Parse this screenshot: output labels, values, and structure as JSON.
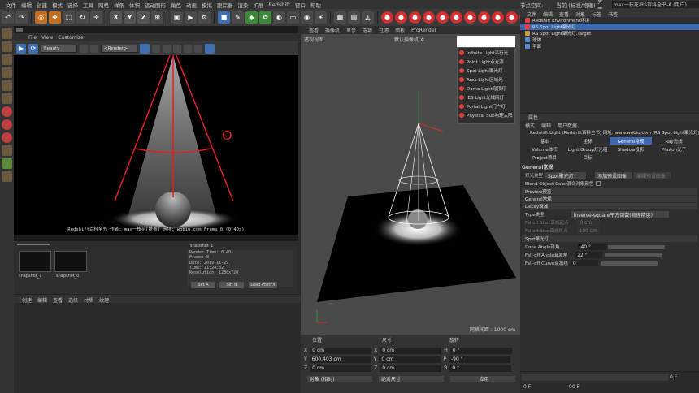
{
  "menubar": {
    "items": [
      "文件",
      "编辑",
      "创建",
      "模式",
      "选择",
      "工具",
      "网格",
      "样条",
      "体积",
      "运动图形",
      "角色",
      "动画",
      "模拟",
      "跟踪器",
      "渲染",
      "扩展",
      "Redshift",
      "窗口",
      "帮助"
    ],
    "node_space_label": "节点空间:",
    "node_space_value": "当前 (标准/物理)",
    "interface_label": "界面:",
    "interface_value": "max一枝花-RS百科全书-A (用户)"
  },
  "toolbar": {
    "axis_letters": [
      "X",
      "Y",
      "Z"
    ]
  },
  "viewport1": {
    "menu": [
      "File",
      "View",
      "Customize"
    ],
    "dropdown1": "Beauty",
    "dropdown2": "<Render>",
    "stamp": "Redshift百科全书  作者: max一枝花[扶善]  网址: wobiu.com  Frame 0  (0.40s)",
    "annotation": "O"
  },
  "snapshots": {
    "title": "snapshot_1",
    "items": [
      "snapshot_1",
      "snapshot_0"
    ],
    "info_lines": [
      "Render Time: 0.40s",
      "Frame: 0",
      "Date: 2019-11-29",
      "Time: 11:24:32",
      "Resolution: 1280x720"
    ],
    "buttons": [
      "Set A",
      "Set B",
      "Load PostFX"
    ]
  },
  "material_manager": {
    "menu": [
      "创建",
      "编辑",
      "查看",
      "选择",
      "材质",
      "纹理"
    ]
  },
  "viewport2": {
    "menu": [
      "查看",
      "摄像机",
      "显示",
      "选项",
      "过滤",
      "面板",
      "ProRender"
    ],
    "label": "透视视图",
    "camera": "默认摄像机 ✲",
    "grid_info": "网格间距 : 1000 cm"
  },
  "light_menu": {
    "items": [
      "Infinite Light平行光",
      "Point Light点光源",
      "Spot Light聚光灯",
      "Area Light区域光",
      "Dome Light穹顶灯",
      "IES Light光域网灯",
      "Portal Light门户灯",
      "Physical Sun物理太阳"
    ]
  },
  "coordinates": {
    "headers": [
      "位置",
      "尺寸",
      "旋转"
    ],
    "rows": [
      {
        "axis": "X",
        "pos": "0 cm",
        "size_axis": "X",
        "size": "0 cm",
        "rot_axis": "H",
        "rot": "0 °"
      },
      {
        "axis": "Y",
        "pos": "600.403 cm",
        "size_axis": "Y",
        "size": "0 cm",
        "rot_axis": "P",
        "rot": "-90 °"
      },
      {
        "axis": "Z",
        "pos": "0 cm",
        "size_axis": "Z",
        "size": "0 cm",
        "rot_axis": "B",
        "rot": "0 °"
      }
    ],
    "mode1": "对象 (相对)",
    "mode2": "绝对尺寸",
    "apply": "应用"
  },
  "object_manager": {
    "menu": [
      "文件",
      "编辑",
      "查看",
      "对象",
      "标签",
      "书签"
    ],
    "objects": [
      "Redshift Environment环境",
      "RS Spot Light聚光灯",
      "RS Spot Light聚光灯.Target",
      "球体",
      "平面"
    ]
  },
  "attributes": {
    "title": "属性",
    "menu": [
      "模式",
      "编辑",
      "用户数据"
    ],
    "header": "Redshift Light  (Redshift百科全书)  网址: www.wobiu.com  [RS Spot Light聚光灯]",
    "tabs": [
      "基本",
      "坐标",
      "General常规",
      "Ray光线",
      "Volume体积",
      "Light Group灯光组",
      "Shadow投影",
      "Photon光子",
      "Project项目",
      "目标"
    ],
    "general_title": "General常规",
    "light_type_label": "灯光类型",
    "light_type_value": "Spot聚光灯",
    "add_preset": "添加预设图像",
    "edit_preset": "编辑预设图像",
    "blend_label": "Blend Object Color混合对象颜色",
    "sections": [
      "Preview预览",
      "General常规",
      "Decay衰减",
      "Spot聚光灯"
    ],
    "decay_type_label": "Type类型",
    "decay_type_value": "Inverse-square平方倒数(物理精度)",
    "falloff_start_label": "Falloff Start衰减起点",
    "falloff_start_value": "0 cm",
    "falloff_stop_label": "Falloff Stop衰减终点",
    "falloff_stop_value": "100 cm",
    "cone_angle_label": "Cone Angle锥角",
    "cone_angle_value": "40 °",
    "falloff_angle_label": "Fall-off Angle衰减角",
    "falloff_angle_value": "22 °",
    "falloff_curve_label": "Fall-off Curve衰减线",
    "falloff_curve_value": "0"
  },
  "timeline": {
    "start": "0 F",
    "end": "0 F",
    "end2": "90 F"
  }
}
